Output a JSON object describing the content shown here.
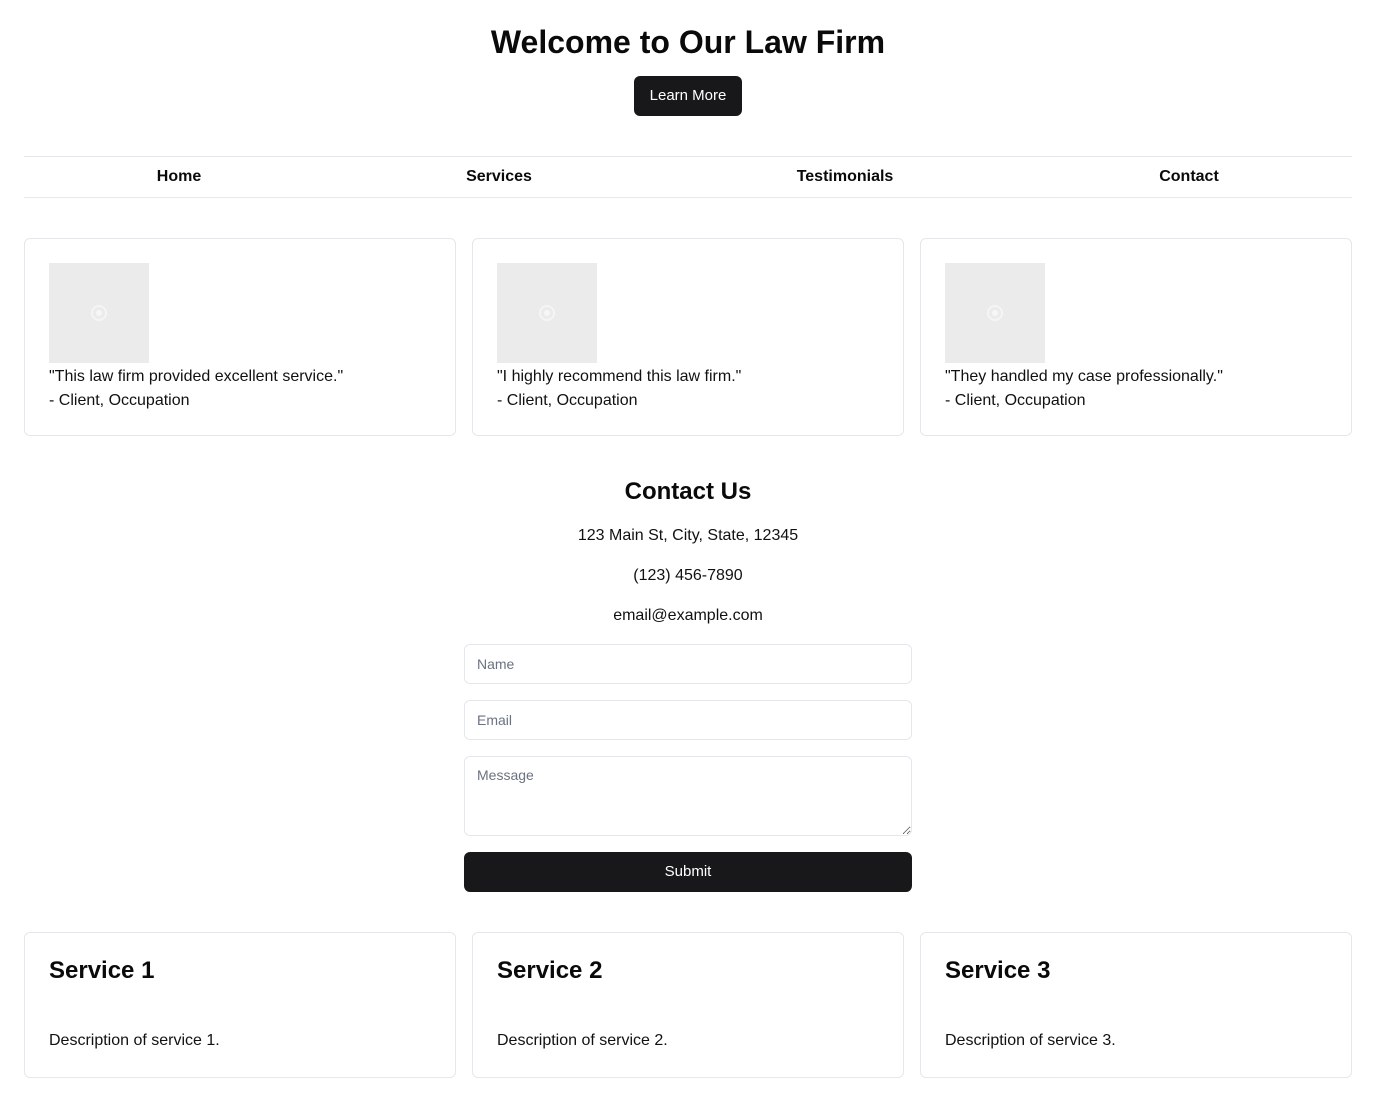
{
  "hero": {
    "title": "Welcome to Our Law Firm",
    "button_label": "Learn More"
  },
  "nav": {
    "items": [
      {
        "label": "Home"
      },
      {
        "label": "Services"
      },
      {
        "label": "Testimonials"
      },
      {
        "label": "Contact"
      }
    ]
  },
  "testimonials": [
    {
      "image": "image-placeholder-icon",
      "quote": "\"This law firm provided excellent service.\"",
      "author": "- Client, Occupation"
    },
    {
      "image": "image-placeholder-icon",
      "quote": "\"I highly recommend this law firm.\"",
      "author": "- Client, Occupation"
    },
    {
      "image": "image-placeholder-icon",
      "quote": "\"They handled my case professionally.\"",
      "author": "- Client, Occupation"
    }
  ],
  "contact": {
    "title": "Contact Us",
    "address": "123 Main St, City, State, 12345",
    "phone": "(123) 456-7890",
    "email": "email@example.com",
    "form": {
      "name_placeholder": "Name",
      "email_placeholder": "Email",
      "message_placeholder": "Message",
      "submit_label": "Submit"
    }
  },
  "services": [
    {
      "title": "Service 1",
      "description": "Description of service 1."
    },
    {
      "title": "Service 2",
      "description": "Description of service 2."
    },
    {
      "title": "Service 3",
      "description": "Description of service 3."
    }
  ],
  "colors": {
    "primary_button": "#18181b",
    "border": "#e5e7eb",
    "placeholder_image": "#ebebeb"
  }
}
